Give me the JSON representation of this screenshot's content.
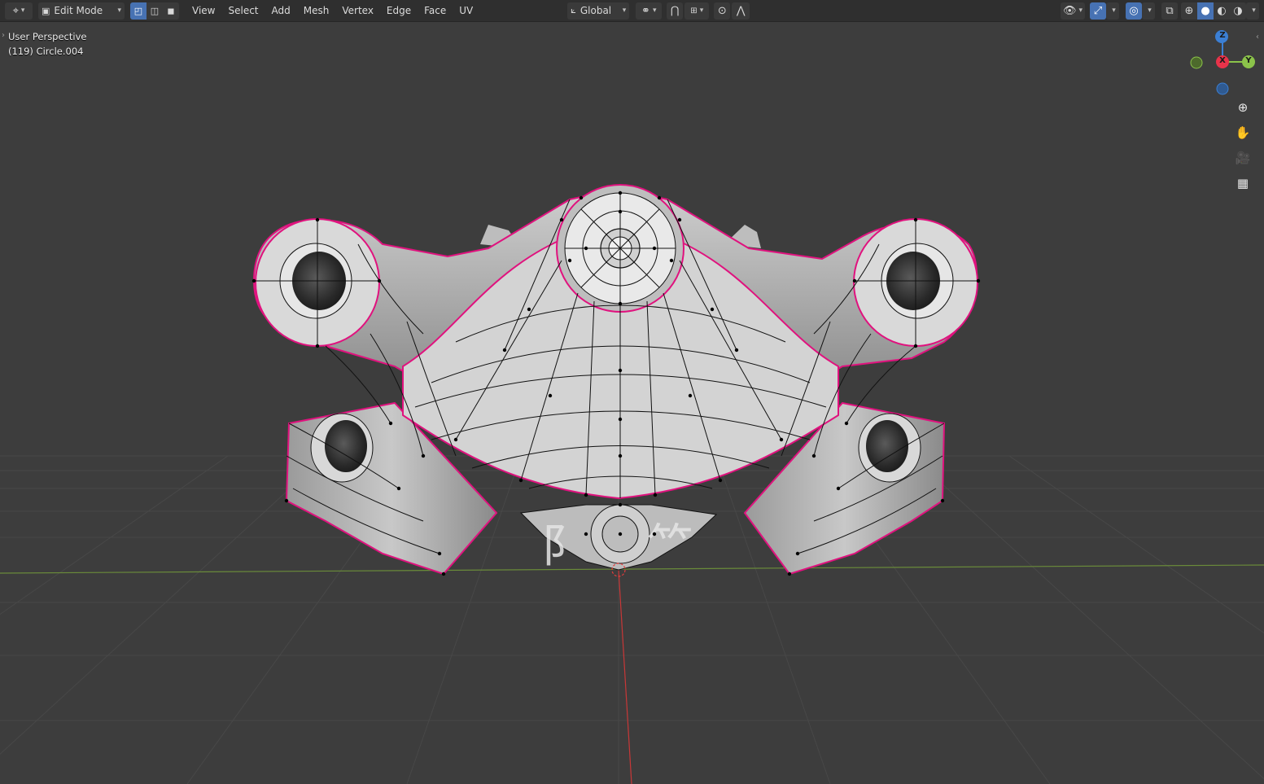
{
  "header": {
    "editor_type_icon": "axis-editor-icon",
    "mode_label": "Edit Mode",
    "menus": [
      "View",
      "Select",
      "Add",
      "Mesh",
      "Vertex",
      "Edge",
      "Face",
      "UV"
    ],
    "transform_orientation": "Global"
  },
  "hud": {
    "view_name": "User Perspective",
    "object_info": "(119) Circle.004"
  },
  "gizmo": {
    "z_label": "Z",
    "x_label": "X",
    "y_label": "Y",
    "colors": {
      "x": "#e8334a",
      "y": "#8bc34a",
      "z": "#3b7fd4"
    }
  },
  "nav_icons": [
    "zoom-icon",
    "hand-pan-icon",
    "camera-icon",
    "grid-ortho-icon"
  ],
  "colors": {
    "background": "#3d3d3d",
    "header": "#2f2f2f",
    "selected_edge": "#e0127e",
    "x_axis_line": "#c83737",
    "y_axis_line": "#6a8b3a"
  }
}
